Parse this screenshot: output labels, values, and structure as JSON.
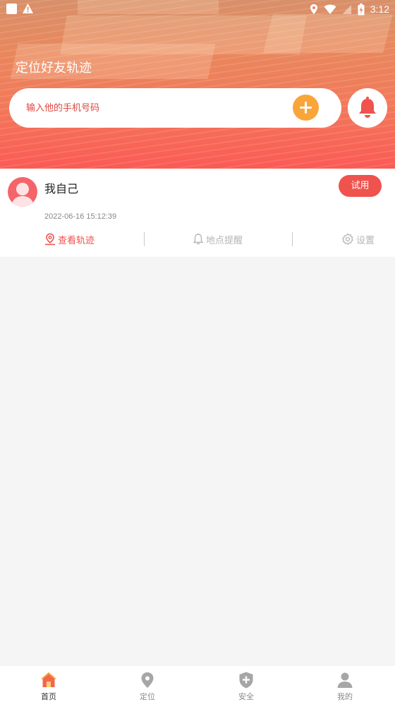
{
  "status_bar": {
    "time": "3:12"
  },
  "header": {
    "title": "定位好友轨迹",
    "search": {
      "placeholder": "输入他的手机号码",
      "value": ""
    }
  },
  "contact": {
    "name": "我自己",
    "trial_label": "试用",
    "timestamp": "2022-06-16 15:12:39",
    "actions": {
      "track": "查看轨迹",
      "remind": "地点提醒",
      "settings": "设置"
    }
  },
  "tabs": [
    {
      "label": "首页",
      "icon": "home-icon",
      "active": true
    },
    {
      "label": "定位",
      "icon": "location-pin-icon",
      "active": false
    },
    {
      "label": "安全",
      "icon": "shield-plus-icon",
      "active": false
    },
    {
      "label": "我的",
      "icon": "user-icon",
      "active": false
    }
  ],
  "colors": {
    "accent": "#f0524e",
    "add_button": "#f9a53a",
    "inactive": "#b5b5b5"
  }
}
